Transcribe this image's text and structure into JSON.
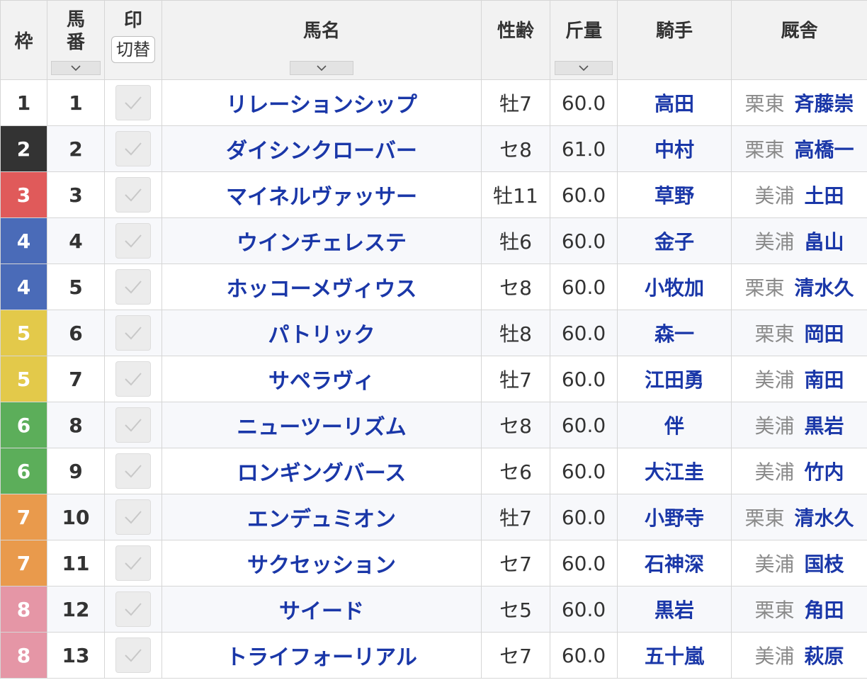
{
  "headers": {
    "waku": "枠",
    "umaban": [
      "馬",
      "番"
    ],
    "mark": "印",
    "mark_toggle": "切替",
    "horse": "馬名",
    "sexage": "性齢",
    "weight": "斤量",
    "jockey": "騎手",
    "stable": "厩舎"
  },
  "colors": {
    "link": "#1a37a8",
    "waku": {
      "1": {
        "bg": "#ffffff",
        "fg": "#333333"
      },
      "2": {
        "bg": "#333333",
        "fg": "#ffffff"
      },
      "3": {
        "bg": "#e05a5a",
        "fg": "#ffffff"
      },
      "4": {
        "bg": "#4a6bb8",
        "fg": "#ffffff"
      },
      "5": {
        "bg": "#e3c94a",
        "fg": "#ffffff"
      },
      "6": {
        "bg": "#5cae5a",
        "fg": "#ffffff"
      },
      "7": {
        "bg": "#e99a4c",
        "fg": "#ffffff"
      },
      "8": {
        "bg": "#e596a6",
        "fg": "#ffffff"
      }
    }
  },
  "rows": [
    {
      "waku": "1",
      "umaban": "1",
      "name": "リレーションシップ",
      "sexage": "牡7",
      "weight": "60.0",
      "jockey": "高田",
      "region": "栗東",
      "trainer": "斉藤崇"
    },
    {
      "waku": "2",
      "umaban": "2",
      "name": "ダイシンクローバー",
      "sexage": "セ8",
      "weight": "61.0",
      "jockey": "中村",
      "region": "栗東",
      "trainer": "高橋一"
    },
    {
      "waku": "3",
      "umaban": "3",
      "name": "マイネルヴァッサー",
      "sexage": "牡11",
      "weight": "60.0",
      "jockey": "草野",
      "region": "美浦",
      "trainer": "土田"
    },
    {
      "waku": "4",
      "umaban": "4",
      "name": "ウインチェレステ",
      "sexage": "牡6",
      "weight": "60.0",
      "jockey": "金子",
      "region": "美浦",
      "trainer": "畠山"
    },
    {
      "waku": "4",
      "umaban": "5",
      "name": "ホッコーメヴィウス",
      "sexage": "セ8",
      "weight": "60.0",
      "jockey": "小牧加",
      "region": "栗東",
      "trainer": "清水久"
    },
    {
      "waku": "5",
      "umaban": "6",
      "name": "パトリック",
      "sexage": "牡8",
      "weight": "60.0",
      "jockey": "森一",
      "region": "栗東",
      "trainer": "岡田"
    },
    {
      "waku": "5",
      "umaban": "7",
      "name": "サペラヴィ",
      "sexage": "牡7",
      "weight": "60.0",
      "jockey": "江田勇",
      "region": "美浦",
      "trainer": "南田"
    },
    {
      "waku": "6",
      "umaban": "8",
      "name": "ニューツーリズム",
      "sexage": "セ8",
      "weight": "60.0",
      "jockey": "伴",
      "region": "美浦",
      "trainer": "黒岩"
    },
    {
      "waku": "6",
      "umaban": "9",
      "name": "ロンギングバース",
      "sexage": "セ6",
      "weight": "60.0",
      "jockey": "大江圭",
      "region": "美浦",
      "trainer": "竹内"
    },
    {
      "waku": "7",
      "umaban": "10",
      "name": "エンデュミオン",
      "sexage": "牡7",
      "weight": "60.0",
      "jockey": "小野寺",
      "region": "栗東",
      "trainer": "清水久"
    },
    {
      "waku": "7",
      "umaban": "11",
      "name": "サクセッション",
      "sexage": "セ7",
      "weight": "60.0",
      "jockey": "石神深",
      "region": "美浦",
      "trainer": "国枝"
    },
    {
      "waku": "8",
      "umaban": "12",
      "name": "サイード",
      "sexage": "セ5",
      "weight": "60.0",
      "jockey": "黒岩",
      "region": "栗東",
      "trainer": "角田"
    },
    {
      "waku": "8",
      "umaban": "13",
      "name": "トライフォーリアル",
      "sexage": "セ7",
      "weight": "60.0",
      "jockey": "五十嵐",
      "region": "美浦",
      "trainer": "萩原"
    }
  ]
}
